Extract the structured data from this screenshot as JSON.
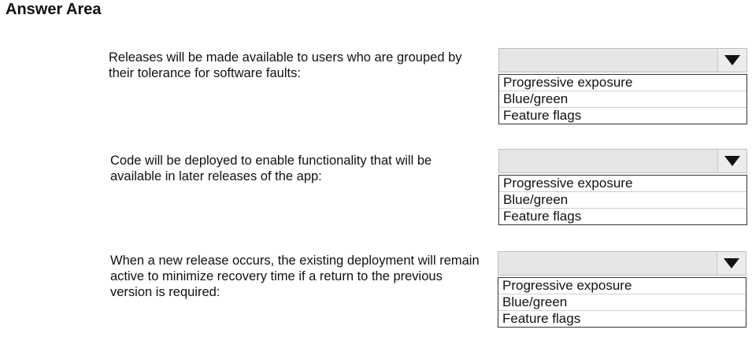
{
  "title": "Answer Area",
  "questions": [
    {
      "text": "Releases will be made available to users who are grouped by their tolerance for software faults:",
      "options": [
        "Progressive exposure",
        "Blue/green",
        "Feature flags"
      ]
    },
    {
      "text": "Code will be deployed to enable functionality that will be available in later releases of the app:",
      "options": [
        "Progressive exposure",
        "Blue/green",
        "Feature flags"
      ]
    },
    {
      "text": "When a new release occurs, the existing deployment will remain active to minimize recovery time if a return to the previous version is required:",
      "options": [
        "Progressive exposure",
        "Blue/green",
        "Feature flags"
      ]
    }
  ],
  "icons": {
    "dropdown_arrow": "chevron-down-icon"
  }
}
